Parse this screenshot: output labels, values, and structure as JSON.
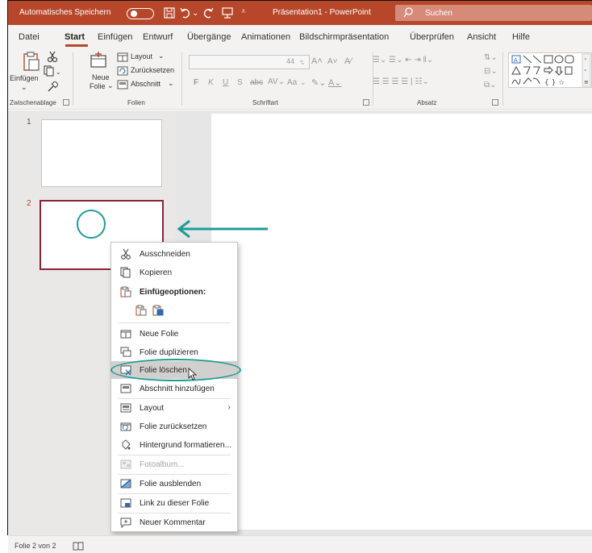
{
  "titlebar": {
    "autosave_label": "Automatisches Speichern",
    "document_title": "Präsentation1  -  PowerPoint",
    "search_placeholder": "Suchen"
  },
  "tabs": [
    {
      "label": "Datei"
    },
    {
      "label": "Start",
      "active": true
    },
    {
      "label": "Einfügen"
    },
    {
      "label": "Entwurf"
    },
    {
      "label": "Übergänge"
    },
    {
      "label": "Animationen"
    },
    {
      "label": "Bildschirmpräsentation"
    },
    {
      "label": "Überprüfen"
    },
    {
      "label": "Ansicht"
    },
    {
      "label": "Hilfe"
    }
  ],
  "ribbon": {
    "clipboard": {
      "paste_label": "Einfügen",
      "group_label": "Zwischenablage"
    },
    "slides": {
      "new_slide_line1": "Neue",
      "new_slide_line2": "Folie",
      "layout_label": "Layout",
      "reset_label": "Zurücksetzen",
      "section_label": "Abschnitt",
      "group_label": "Folien"
    },
    "font": {
      "size_value": "44",
      "group_label": "Schriftart",
      "bold": "F",
      "italic": "K",
      "underline": "U",
      "strike": "S",
      "case": "Aa"
    },
    "paragraph": {
      "group_label": "Absatz"
    }
  },
  "slides": [
    {
      "number": "1",
      "selected": false
    },
    {
      "number": "2",
      "selected": true
    }
  ],
  "context_menu": {
    "items": [
      {
        "label": "Ausschneiden",
        "icon": "scissors-icon"
      },
      {
        "label": "Kopieren",
        "icon": "copy-icon"
      },
      {
        "label": "Einfügeoptionen:",
        "icon": "paste-icon",
        "bold": true
      },
      {
        "label": "Neue Folie",
        "icon": "new-slide-icon"
      },
      {
        "label": "Folie duplizieren",
        "icon": "duplicate-slide-icon"
      },
      {
        "label": "Folie löschen",
        "icon": "delete-slide-icon",
        "hover": true
      },
      {
        "label": "Abschnitt hinzufügen",
        "icon": "add-section-icon"
      },
      {
        "label": "Layout",
        "icon": "layout-icon"
      },
      {
        "label": "Folie zurücksetzen",
        "icon": "reset-slide-icon"
      },
      {
        "label": "Hintergrund formatieren...",
        "icon": "format-background-icon"
      },
      {
        "label": "Fotoalbum...",
        "icon": "photo-album-icon",
        "disabled": true
      },
      {
        "label": "Folie ausblenden",
        "icon": "hide-slide-icon"
      },
      {
        "label": "Link zu dieser Folie",
        "icon": "link-slide-icon"
      },
      {
        "label": "Neuer Kommentar",
        "icon": "comment-icon"
      }
    ]
  },
  "statusbar": {
    "slide_info": "Folie 2 von 2"
  },
  "colors": {
    "accent": "#b7472a",
    "annotation": "#1f9c96",
    "selected_thumb": "#8c2431"
  }
}
